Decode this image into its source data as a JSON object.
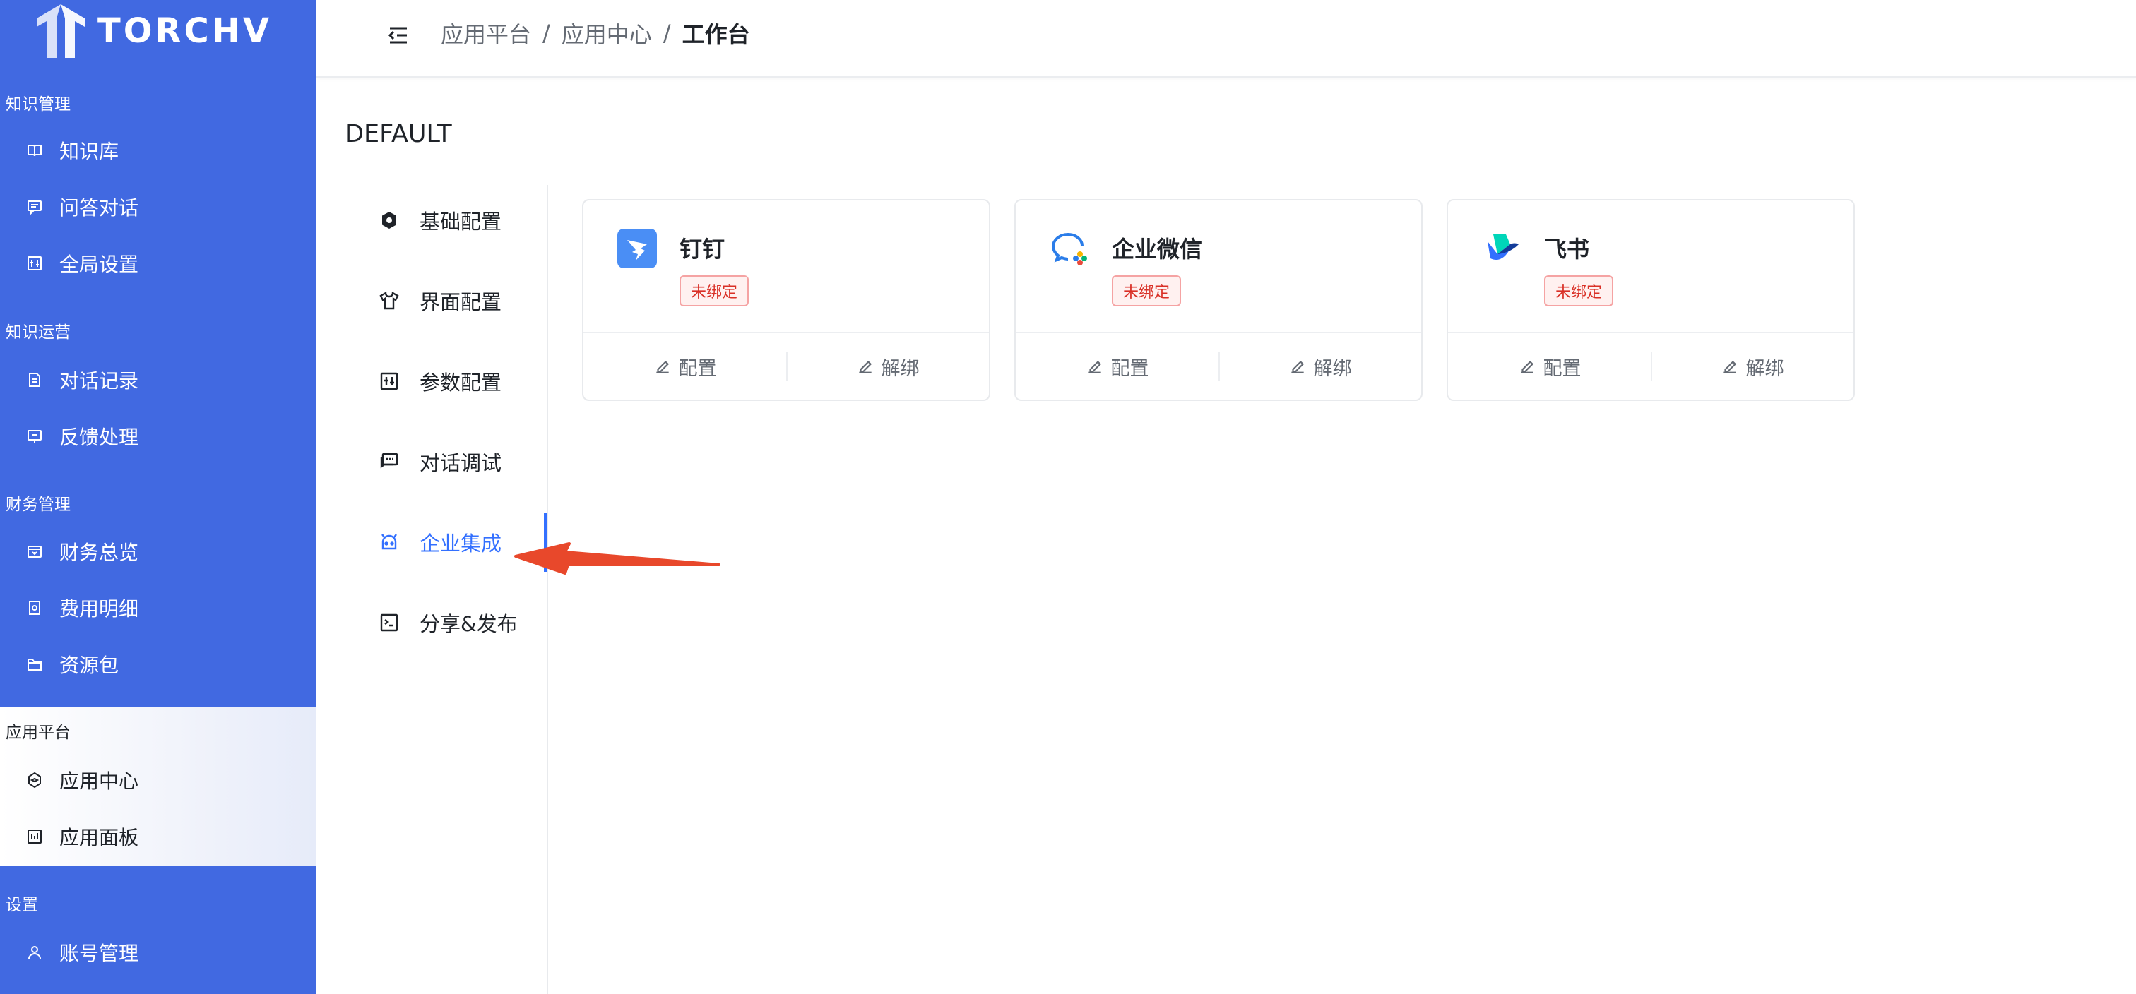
{
  "brand": {
    "name": "TORCHV"
  },
  "sidebar": {
    "sections": [
      {
        "title": "知识管理",
        "items": [
          {
            "label": "知识库",
            "icon": "book-icon"
          },
          {
            "label": "问答对话",
            "icon": "chat-icon"
          },
          {
            "label": "全局设置",
            "icon": "settings-panel-icon"
          }
        ]
      },
      {
        "title": "知识运营",
        "items": [
          {
            "label": "对话记录",
            "icon": "document-icon"
          },
          {
            "label": "反馈处理",
            "icon": "feedback-icon"
          }
        ]
      },
      {
        "title": "财务管理",
        "items": [
          {
            "label": "财务总览",
            "icon": "finance-icon"
          },
          {
            "label": "费用明细",
            "icon": "invoice-icon"
          },
          {
            "label": "资源包",
            "icon": "folder-icon"
          }
        ]
      },
      {
        "title": "应用平台",
        "items": [
          {
            "label": "应用中心",
            "icon": "app-cube-icon"
          },
          {
            "label": "应用面板",
            "icon": "dashboard-icon"
          }
        ]
      },
      {
        "title": "设置",
        "items": [
          {
            "label": "账号管理",
            "icon": "user-icon"
          }
        ]
      }
    ],
    "active_section": "应用平台"
  },
  "header": {
    "breadcrumb": [
      "应用平台",
      "应用中心",
      "工作台"
    ],
    "separator": "/"
  },
  "page": {
    "title": "DEFAULT"
  },
  "tabs": [
    {
      "label": "基础配置",
      "icon": "gear-icon"
    },
    {
      "label": "界面配置",
      "icon": "shirt-icon"
    },
    {
      "label": "参数配置",
      "icon": "parameter-icon"
    },
    {
      "label": "对话调试",
      "icon": "chat-debug-icon"
    },
    {
      "label": "企业集成",
      "icon": "robot-icon"
    },
    {
      "label": "分享&发布",
      "icon": "terminal-icon"
    }
  ],
  "active_tab": "企业集成",
  "integrations": [
    {
      "name": "钉钉",
      "status": "未绑定",
      "config_label": "配置",
      "unbind_label": "解绑",
      "logo": "dingtalk-logo"
    },
    {
      "name": "企业微信",
      "status": "未绑定",
      "config_label": "配置",
      "unbind_label": "解绑",
      "logo": "wecom-logo"
    },
    {
      "name": "飞书",
      "status": "未绑定",
      "config_label": "配置",
      "unbind_label": "解绑",
      "logo": "feishu-logo"
    }
  ],
  "colors": {
    "sidebar_bg": "#4169e1",
    "accent": "#3370ff",
    "badge_text": "#d93026",
    "badge_border": "#f5a3a3",
    "annotation_arrow": "#e8482b"
  }
}
